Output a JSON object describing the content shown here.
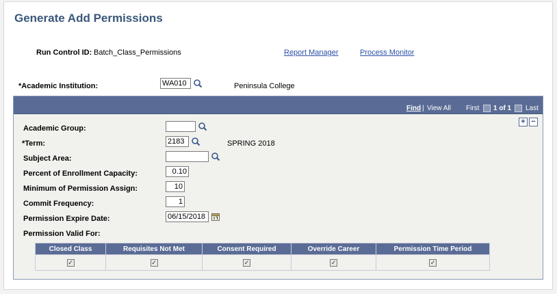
{
  "page": {
    "title": "Generate Add Permissions"
  },
  "run_control": {
    "label": "Run Control ID:",
    "value": "Batch_Class_Permissions",
    "report_manager": "Report Manager",
    "process_monitor": "Process Monitor"
  },
  "institution": {
    "label": "*Academic Institution:",
    "value": "WA010",
    "description": "Peninsula College"
  },
  "navbar": {
    "find": "Find",
    "separator": "|",
    "view_all": "View All",
    "first": "First",
    "paging": "1 of 1",
    "last": "Last"
  },
  "fields": {
    "academic_group": {
      "label": "Academic Group:",
      "value": ""
    },
    "term": {
      "label": "*Term:",
      "value": "2183",
      "description": "SPRING 2018"
    },
    "subject_area": {
      "label": "Subject Area:",
      "value": ""
    },
    "percent_capacity": {
      "label": "Percent of Enrollment Capacity:",
      "value": "0.10"
    },
    "min_permission": {
      "label": "Minimum of Permission Assign:",
      "value": "10"
    },
    "commit_frequency": {
      "label": "Commit Frequency:",
      "value": "1"
    },
    "expire_date": {
      "label": "Permission Expire Date:",
      "value": "06/15/2018"
    }
  },
  "permission_valid": {
    "label": "Permission Valid For:",
    "columns": [
      "Closed Class",
      "Requisites Not Met",
      "Consent Required",
      "Override Career",
      "Permission Time Period"
    ],
    "checked": [
      true,
      true,
      true,
      true,
      true
    ]
  },
  "colors": {
    "title": "#3a5779",
    "header_bar": "#5a6c95",
    "link": "#2a50a8"
  }
}
